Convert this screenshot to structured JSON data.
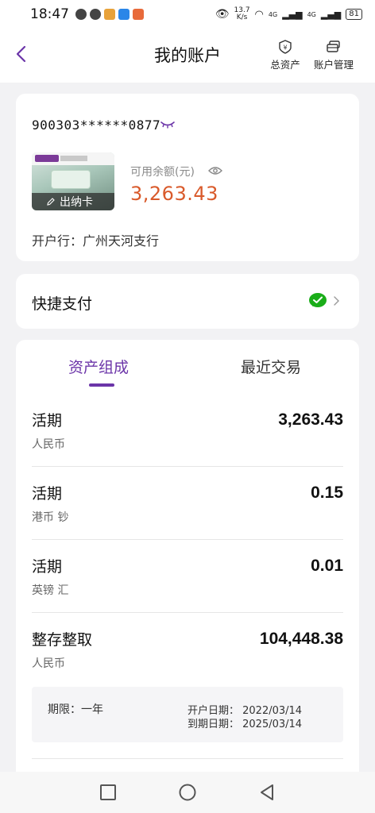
{
  "status_bar": {
    "time": "18:47",
    "net_speed_value": "13.7",
    "net_speed_unit": "K/s",
    "signal1": "4G",
    "signal2": "4G",
    "battery": "81"
  },
  "header": {
    "title": "我的账户",
    "total_assets_label": "总资产",
    "account_manage_label": "账户管理"
  },
  "account": {
    "number": "900303******0877",
    "card_tag": "出纳卡",
    "balance_label": "可用余额(元)",
    "balance_value": "3,263.43",
    "branch": "开户行：广州天河支行"
  },
  "quick_pay": {
    "label": "快捷支付"
  },
  "tabs": [
    {
      "label": "资产组成",
      "active": true
    },
    {
      "label": "最近交易",
      "active": false
    }
  ],
  "assets": [
    {
      "type": "活期",
      "currency": "人民币",
      "amount": "3,263.43"
    },
    {
      "type": "活期",
      "currency": "港币 钞",
      "amount": "0.15"
    },
    {
      "type": "活期",
      "currency": "英镑 汇",
      "amount": "0.01"
    },
    {
      "type": "整存整取",
      "currency": "人民币",
      "amount": "104,448.38"
    }
  ],
  "term_deposit": {
    "term": "期限：一年",
    "open_date": "开户日期：  2022/03/14",
    "due_date": "到期日期：  2025/03/14"
  },
  "colors": {
    "accent": "#6b34a8",
    "balance": "#d95a2b",
    "wechat": "#1aad19"
  }
}
